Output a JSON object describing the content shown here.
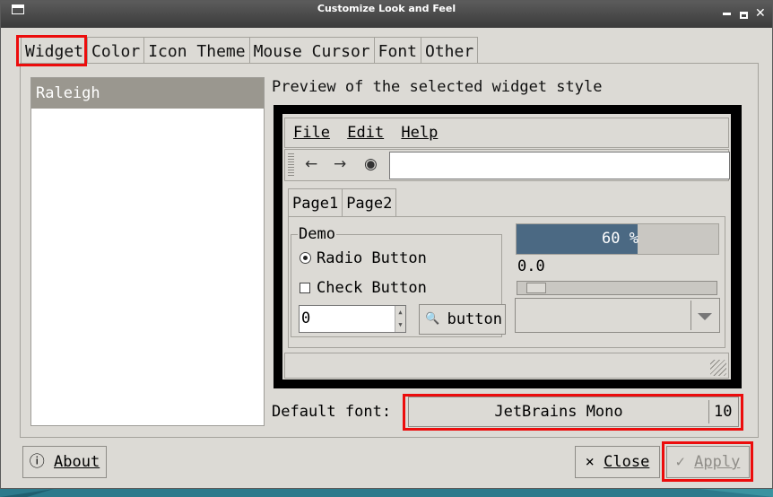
{
  "window": {
    "title": "Customize Look and Feel"
  },
  "tabs": [
    "Widget",
    "Color",
    "Icon Theme",
    "Mouse Cursor",
    "Font",
    "Other"
  ],
  "theme_list": {
    "items": [
      "Raleigh"
    ],
    "selected": "Raleigh"
  },
  "preview": {
    "label": "Preview of the selected widget style",
    "menu": {
      "file": "File",
      "edit": "Edit",
      "help": "Help"
    },
    "toolbar": {
      "back": "←",
      "forward": "→",
      "stop": "◉"
    },
    "notebook_tabs": [
      "Page1",
      "Page2"
    ],
    "frame_label": "Demo",
    "radio_label": "Radio Button",
    "check_label": "Check Button",
    "spin_value": "0",
    "button_label": "button",
    "progress_text": "60 %",
    "progress_fraction": 0.6,
    "scale_value": "0.0"
  },
  "default_font": {
    "label": "Default font:",
    "name": "JetBrains Mono",
    "size": "10"
  },
  "buttons": {
    "about": "About",
    "close": "Close",
    "apply": "Apply"
  }
}
